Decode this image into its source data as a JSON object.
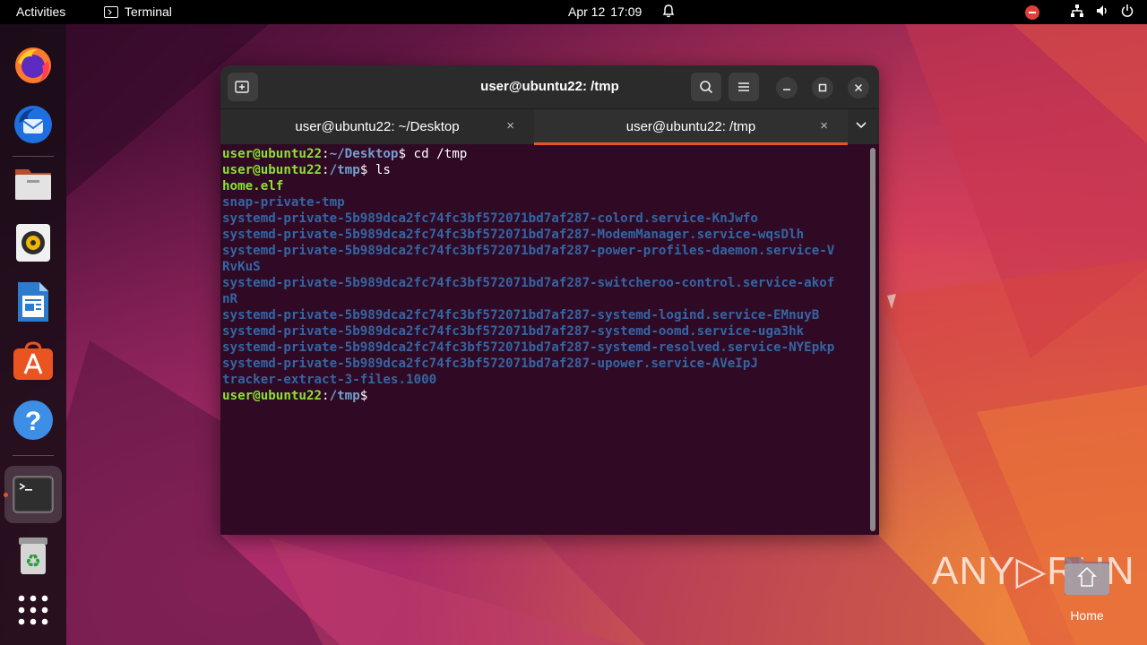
{
  "topbar": {
    "activities": "Activities",
    "app_name": "Terminal",
    "date": "Apr 12",
    "time": "17:09"
  },
  "dock": {
    "items": [
      {
        "name": "firefox-icon"
      },
      {
        "name": "thunderbird-icon"
      },
      {
        "name": "files-icon"
      },
      {
        "name": "rhythmbox-icon"
      },
      {
        "name": "libreoffice-writer-icon"
      },
      {
        "name": "app-center-icon"
      },
      {
        "name": "help-icon"
      },
      {
        "name": "terminal-icon"
      },
      {
        "name": "trash-icon"
      },
      {
        "name": "show-apps-icon"
      }
    ]
  },
  "window": {
    "title": "user@ubuntu22: /tmp",
    "tabs": [
      {
        "label": "user@ubuntu22: ~/Desktop",
        "active": false
      },
      {
        "label": "user@ubuntu22: /tmp",
        "active": true
      }
    ]
  },
  "terminal": {
    "user": "user@ubuntu22",
    "lines": [
      {
        "type": "prompt",
        "path": "~/Desktop",
        "cmd": " cd /tmp"
      },
      {
        "type": "prompt",
        "path": "/tmp",
        "cmd": " ls"
      },
      {
        "type": "file",
        "text": "home.elf"
      },
      {
        "type": "dir",
        "text": "snap-private-tmp"
      },
      {
        "type": "dir",
        "text": "systemd-private-5b989dca2fc74fc3bf572071bd7af287-colord.service-KnJwfo"
      },
      {
        "type": "dir",
        "text": "systemd-private-5b989dca2fc74fc3bf572071bd7af287-ModemManager.service-wqsDlh"
      },
      {
        "type": "dir",
        "text": "systemd-private-5b989dca2fc74fc3bf572071bd7af287-power-profiles-daemon.service-V"
      },
      {
        "type": "dir",
        "text": "RvKuS"
      },
      {
        "type": "dir",
        "text": "systemd-private-5b989dca2fc74fc3bf572071bd7af287-switcheroo-control.service-akof"
      },
      {
        "type": "dir",
        "text": "nR"
      },
      {
        "type": "dir",
        "text": "systemd-private-5b989dca2fc74fc3bf572071bd7af287-systemd-logind.service-EMnuyB"
      },
      {
        "type": "dir",
        "text": "systemd-private-5b989dca2fc74fc3bf572071bd7af287-systemd-oomd.service-uga3hk"
      },
      {
        "type": "dir",
        "text": "systemd-private-5b989dca2fc74fc3bf572071bd7af287-systemd-resolved.service-NYEpkp"
      },
      {
        "type": "dir",
        "text": "systemd-private-5b989dca2fc74fc3bf572071bd7af287-upower.service-AVeIpJ"
      },
      {
        "type": "dir",
        "text": "tracker-extract-3-files.1000"
      },
      {
        "type": "prompt",
        "path": "/tmp",
        "cmd": ""
      }
    ]
  },
  "desktop": {
    "watermark": "ANY▷RUN",
    "home_label": "Home"
  }
}
